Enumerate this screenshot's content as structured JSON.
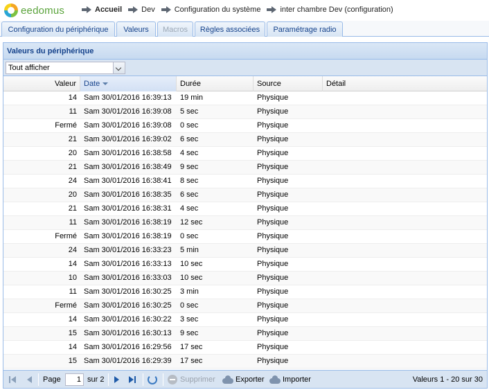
{
  "app": {
    "logo_text": "eedomus"
  },
  "breadcrumb": [
    "Accueil",
    "Dev",
    "Configuration du système",
    "inter chambre Dev (configuration)"
  ],
  "tabs": [
    {
      "label": "Configuration du périphérique",
      "disabled": false
    },
    {
      "label": "Valeurs",
      "disabled": false
    },
    {
      "label": "Macros",
      "disabled": true
    },
    {
      "label": "Règles associées",
      "disabled": false
    },
    {
      "label": "Paramétrage radio",
      "disabled": false
    }
  ],
  "panel": {
    "title": "Valeurs du périphérique"
  },
  "filter": {
    "value": "Tout afficher"
  },
  "grid": {
    "columns": [
      "Valeur",
      "Date",
      "Durée",
      "Source",
      "Détail"
    ],
    "sorted_column": "Date",
    "rows": [
      [
        "14",
        "Sam 30/01/2016 16:39:13",
        "19 min",
        "Physique",
        ""
      ],
      [
        "11",
        "Sam 30/01/2016 16:39:08",
        "5 sec",
        "Physique",
        ""
      ],
      [
        "Fermé",
        "Sam 30/01/2016 16:39:08",
        "0 sec",
        "Physique",
        ""
      ],
      [
        "21",
        "Sam 30/01/2016 16:39:02",
        "6 sec",
        "Physique",
        ""
      ],
      [
        "20",
        "Sam 30/01/2016 16:38:58",
        "4 sec",
        "Physique",
        ""
      ],
      [
        "21",
        "Sam 30/01/2016 16:38:49",
        "9 sec",
        "Physique",
        ""
      ],
      [
        "24",
        "Sam 30/01/2016 16:38:41",
        "8 sec",
        "Physique",
        ""
      ],
      [
        "20",
        "Sam 30/01/2016 16:38:35",
        "6 sec",
        "Physique",
        ""
      ],
      [
        "21",
        "Sam 30/01/2016 16:38:31",
        "4 sec",
        "Physique",
        ""
      ],
      [
        "11",
        "Sam 30/01/2016 16:38:19",
        "12 sec",
        "Physique",
        ""
      ],
      [
        "Fermé",
        "Sam 30/01/2016 16:38:19",
        "0 sec",
        "Physique",
        ""
      ],
      [
        "24",
        "Sam 30/01/2016 16:33:23",
        "5 min",
        "Physique",
        ""
      ],
      [
        "14",
        "Sam 30/01/2016 16:33:13",
        "10 sec",
        "Physique",
        ""
      ],
      [
        "10",
        "Sam 30/01/2016 16:33:03",
        "10 sec",
        "Physique",
        ""
      ],
      [
        "11",
        "Sam 30/01/2016 16:30:25",
        "3 min",
        "Physique",
        ""
      ],
      [
        "Fermé",
        "Sam 30/01/2016 16:30:25",
        "0 sec",
        "Physique",
        ""
      ],
      [
        "14",
        "Sam 30/01/2016 16:30:22",
        "3 sec",
        "Physique",
        ""
      ],
      [
        "15",
        "Sam 30/01/2016 16:30:13",
        "9 sec",
        "Physique",
        ""
      ],
      [
        "14",
        "Sam 30/01/2016 16:29:56",
        "17 sec",
        "Physique",
        ""
      ],
      [
        "15",
        "Sam 30/01/2016 16:29:39",
        "17 sec",
        "Physique",
        ""
      ]
    ]
  },
  "paging": {
    "page_label": "Page",
    "page_value": "1",
    "of_label": "sur 2",
    "delete_label": "Supprimer",
    "export_label": "Exporter",
    "import_label": "Importer",
    "summary": "Valeurs 1 - 20 sur 30"
  },
  "colors": {
    "accent": "#15428b",
    "border": "#99bbe8",
    "toolbar": "#d8e4f2"
  }
}
